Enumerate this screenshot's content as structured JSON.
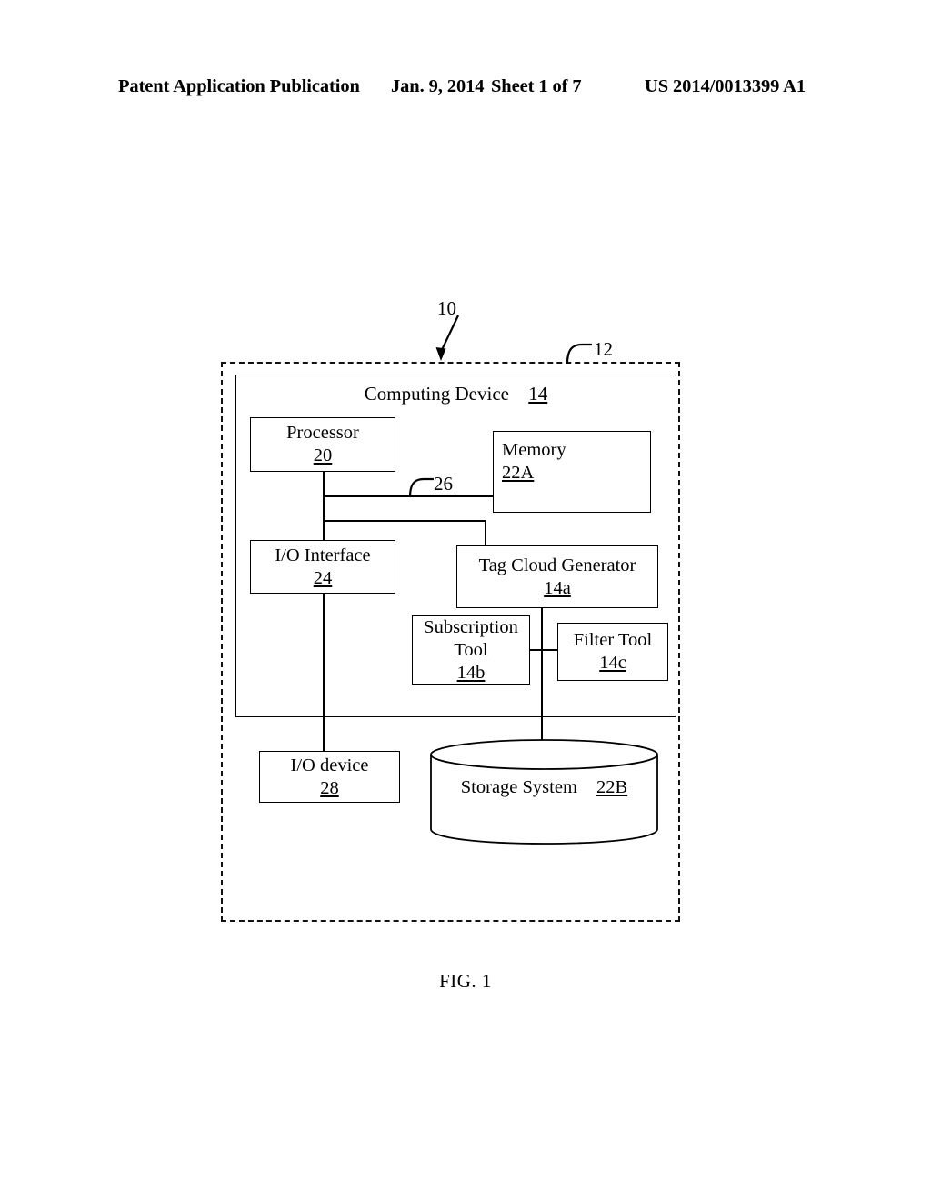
{
  "header": {
    "title": "Patent Application Publication",
    "date": "Jan. 9, 2014",
    "sheet": "Sheet 1 of 7",
    "publication_number": "US 2014/0013399 A1"
  },
  "figure": {
    "caption": "FIG. 1",
    "system_boundary": {
      "ref": "12",
      "style": "dashed"
    },
    "pointer_label": {
      "ref": "10",
      "target": "system-boundary"
    },
    "bus": {
      "ref": "26"
    },
    "container": {
      "label": "Computing Device",
      "ref": "14"
    },
    "components": [
      {
        "name": "processor",
        "label": "Processor",
        "ref": "20"
      },
      {
        "name": "memory",
        "label": "Memory",
        "ref": "22A"
      },
      {
        "name": "io_interface",
        "label": "I/O Interface",
        "ref": "24"
      },
      {
        "name": "tag_cloud",
        "label": "Tag Cloud Generator",
        "ref": "14a"
      },
      {
        "name": "subscription",
        "label_line1": "Subscription",
        "label_line2": "Tool",
        "ref": "14b"
      },
      {
        "name": "filter_tool",
        "label": "Filter Tool",
        "ref": "14c"
      },
      {
        "name": "io_device",
        "label": "I/O device",
        "ref": "28"
      },
      {
        "name": "storage",
        "label": "Storage System",
        "ref": "22B"
      }
    ]
  },
  "colors": {
    "ink": "#000000",
    "page": "#ffffff"
  }
}
